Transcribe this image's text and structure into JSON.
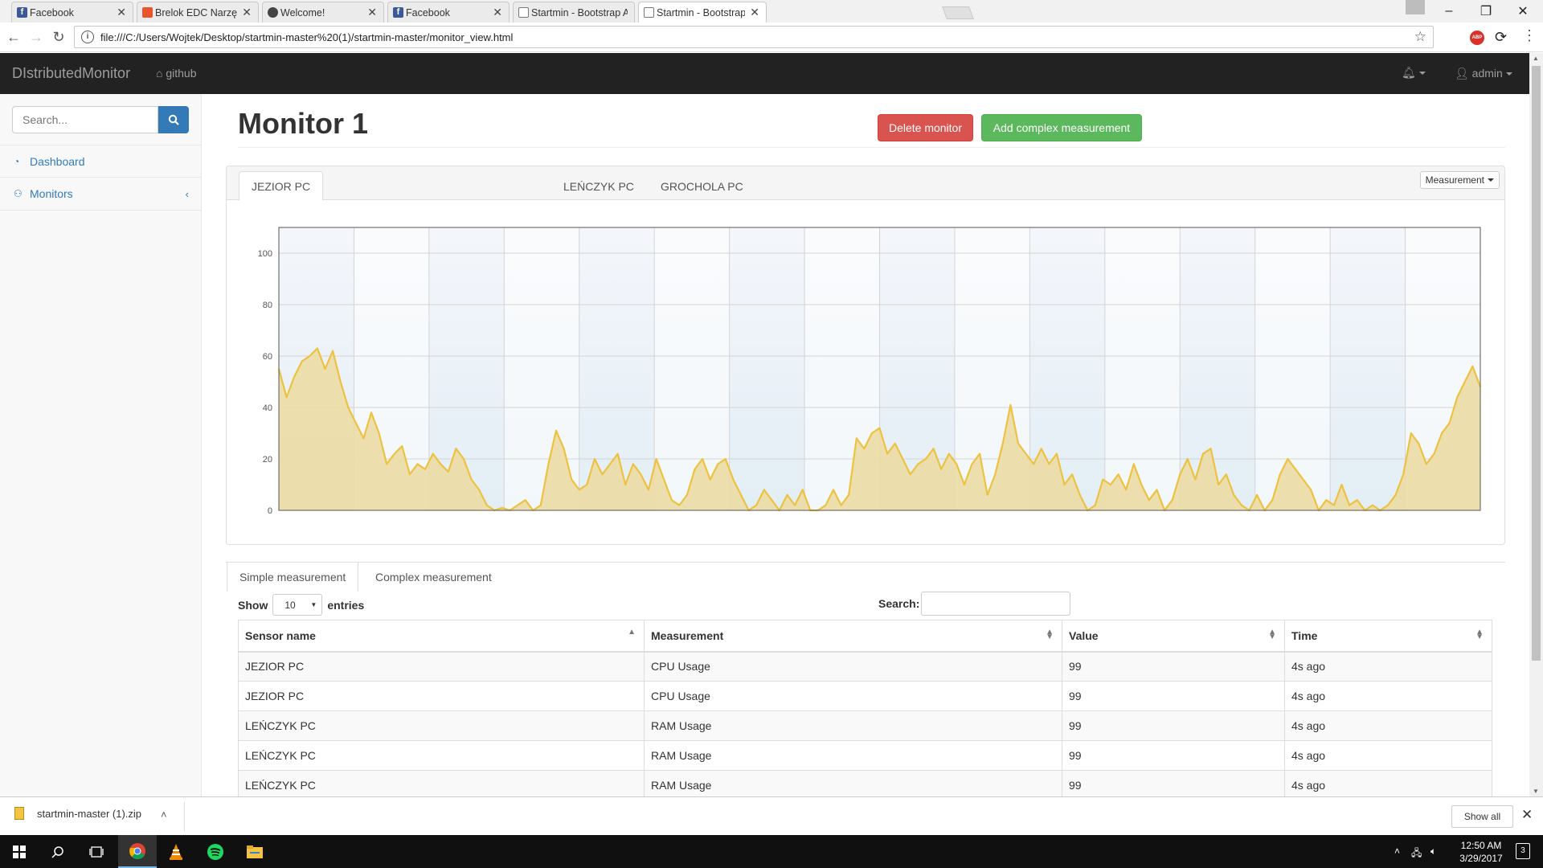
{
  "browser": {
    "tabs": [
      {
        "title": "Facebook",
        "icon": "facebook-icon"
      },
      {
        "title": "Brelok EDC Narzędzia Kl",
        "icon": "shop-icon"
      },
      {
        "title": "Welcome!",
        "icon": "welcome-icon"
      },
      {
        "title": "Facebook",
        "icon": "facebook-icon"
      },
      {
        "title": "Startmin - Bootstrap Adi",
        "icon": "page-icon"
      },
      {
        "title": "Startmin - Bootstrap Adi",
        "icon": "page-icon",
        "active": true
      }
    ],
    "url": "file:///C:/Users/Wojtek/Desktop/startmin-master%20(1)/startmin-master/monitor_view.html"
  },
  "navbar": {
    "brand": "DIstributedMonitor",
    "github": "github",
    "user": "admin"
  },
  "sidebar": {
    "search_placeholder": "Search...",
    "items": [
      {
        "label": "Dashboard",
        "icon": "dashboard-icon"
      },
      {
        "label": "Monitors",
        "icon": "sitemap-icon"
      }
    ]
  },
  "main": {
    "title": "Monitor 1",
    "delete_button": "Delete monitor",
    "add_button": "Add complex measurement",
    "chart_tabs": [
      "JEZIOR PC",
      "LEŃCZYK PC",
      "GROCHOLA PC"
    ],
    "measurement_dropdown": "Measurement",
    "table_tabs": [
      "Simple measurement",
      "Complex measurement"
    ],
    "show_label": "Show",
    "entries_value": "10",
    "entries_label": "entries",
    "search_label": "Search:",
    "table": {
      "columns": [
        "Sensor name",
        "Measurement",
        "Value",
        "Time"
      ],
      "rows": [
        [
          "JEZIOR PC",
          "CPU Usage",
          "99",
          "4s ago"
        ],
        [
          "JEZIOR PC",
          "CPU Usage",
          "99",
          "4s ago"
        ],
        [
          "LEŃCZYK PC",
          "RAM Usage",
          "99",
          "4s ago"
        ],
        [
          "LEŃCZYK PC",
          "RAM Usage",
          "99",
          "4s ago"
        ],
        [
          "LEŃCZYK PC",
          "RAM Usage",
          "99",
          "4s ago"
        ]
      ]
    }
  },
  "downloads": {
    "file": "startmin-master (1).zip",
    "show_all": "Show all"
  },
  "taskbar": {
    "time": "12:50 AM",
    "date": "3/29/2017",
    "notifications": "3"
  },
  "colors": {
    "series_line": "#edc240",
    "series_fill": "#ecdca4",
    "navbar_bg": "#222222",
    "delete": "#d9534f",
    "add": "#5cb85c",
    "primary": "#337ab7"
  },
  "chart_data": {
    "type": "area",
    "title": "",
    "xlabel": "",
    "ylabel": "",
    "ylim": [
      0,
      110
    ],
    "yticks": [
      0,
      20,
      40,
      60,
      80,
      100
    ],
    "grid": true,
    "x": [
      0,
      1,
      2,
      3,
      4,
      5,
      6,
      7,
      8,
      9,
      10,
      11,
      12,
      13,
      14,
      15,
      16,
      17,
      18,
      19,
      20,
      21,
      22,
      23,
      24,
      25,
      26,
      27,
      28,
      29,
      30,
      31,
      32,
      33,
      34,
      35,
      36,
      37,
      38,
      39,
      40,
      41,
      42,
      43,
      44,
      45,
      46,
      47,
      48,
      49,
      50,
      51,
      52,
      53,
      54,
      55,
      56,
      57,
      58,
      59,
      60,
      61,
      62,
      63,
      64,
      65,
      66,
      67,
      68,
      69,
      70,
      71,
      72,
      73,
      74,
      75,
      76,
      77,
      78,
      79,
      80,
      81,
      82,
      83,
      84,
      85,
      86,
      87,
      88,
      89,
      90,
      91,
      92,
      93,
      94,
      95,
      96,
      97,
      98,
      99,
      100,
      101,
      102,
      103,
      104,
      105,
      106,
      107,
      108,
      109,
      110,
      111,
      112,
      113,
      114,
      115,
      116,
      117,
      118,
      119,
      120,
      121,
      122,
      123,
      124,
      125,
      126,
      127,
      128,
      129,
      130,
      131,
      132,
      133,
      134,
      135,
      136,
      137,
      138,
      139,
      140,
      141,
      142,
      143,
      144,
      145,
      146,
      147,
      148,
      149,
      150,
      151,
      152,
      153,
      154,
      155,
      156
    ],
    "series": [
      {
        "values": [
          55,
          44,
          52,
          58,
          60,
          63,
          55,
          62,
          50,
          40,
          34,
          28,
          38,
          30,
          18,
          22,
          25,
          14,
          18,
          16,
          22,
          18,
          15,
          24,
          20,
          12,
          8,
          2,
          0,
          1,
          0,
          2,
          4,
          0,
          2,
          18,
          31,
          24,
          12,
          8,
          10,
          20,
          14,
          18,
          22,
          10,
          18,
          14,
          8,
          20,
          12,
          4,
          2,
          6,
          16,
          20,
          12,
          18,
          20,
          12,
          6,
          0,
          2,
          8,
          4,
          0,
          6,
          2,
          8,
          0,
          0,
          2,
          8,
          2,
          6,
          28,
          24,
          30,
          32,
          22,
          26,
          20,
          14,
          18,
          20,
          24,
          16,
          22,
          18,
          10,
          18,
          22,
          6,
          14,
          26,
          41,
          26,
          22,
          18,
          24,
          18,
          22,
          10,
          14,
          6,
          0,
          2,
          12,
          10,
          14,
          8,
          18,
          10,
          4,
          8,
          0,
          4,
          14,
          20,
          12,
          22,
          24,
          10,
          14,
          6,
          2,
          0,
          6,
          0,
          4,
          14,
          20,
          16,
          12,
          8,
          0,
          4,
          2,
          10,
          2,
          4,
          0,
          2,
          0,
          2,
          6,
          14,
          30,
          26,
          18,
          22,
          30,
          34,
          44,
          50,
          56,
          48
        ]
      }
    ]
  }
}
